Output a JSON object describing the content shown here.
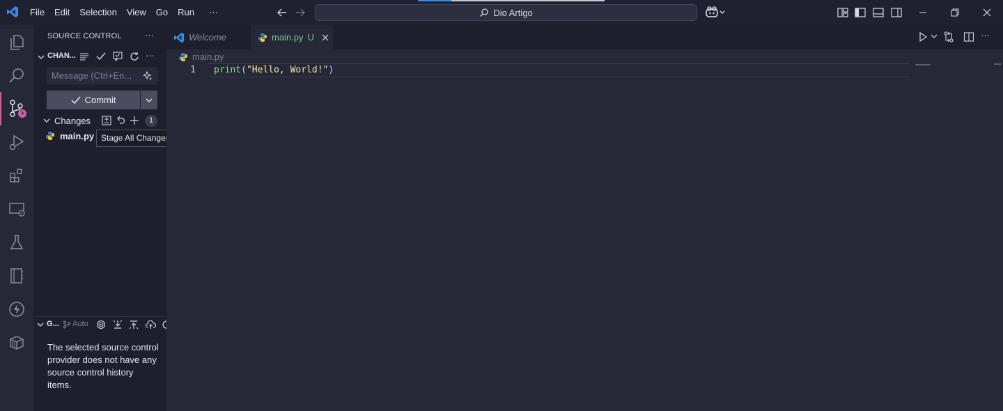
{
  "titlebar": {
    "menu": [
      "File",
      "Edit",
      "Selection",
      "View",
      "Go",
      "Run",
      "···"
    ],
    "search_text": "Dio Artigo",
    "icons": [
      "vscode-logo-icon",
      "back-arrow-icon",
      "forward-arrow-icon",
      "search-icon",
      "copilot-icon",
      "customize-layout-icon",
      "toggle-primary-sidebar-icon",
      "toggle-panel-icon",
      "toggle-secondary-sidebar-icon",
      "minimize-icon",
      "restore-icon",
      "close-icon"
    ]
  },
  "activitybar": {
    "items": [
      "explorer",
      "search",
      "source-control",
      "run-and-debug",
      "extensions",
      "remote-explorer",
      "testing",
      "notebook",
      "thunder",
      "containers"
    ]
  },
  "sidebar": {
    "title": "SOURCE CONTROL",
    "more": "···",
    "changes_header": "CHAN...",
    "commit_message_placeholder": "Message (Ctrl+En...",
    "commit_label": "Commit",
    "changes_label": "Changes",
    "changes_count": "1",
    "file_name": "main.py",
    "tooltip": "Stage All Changes",
    "graph_header": "G...",
    "graph_auto": "Auto",
    "history_message": "The selected source control provider does not have any source control history items."
  },
  "editor": {
    "tabs": [
      {
        "label": "Welcome",
        "active": false
      },
      {
        "label": "main.py",
        "status": "U",
        "active": true
      }
    ],
    "breadcrumb": "main.py",
    "line_number": "1",
    "code": {
      "fn": "print",
      "open": "(",
      "str": "\"Hello, World!\"",
      "close": ")"
    }
  },
  "colors": {
    "accent_blue": "#3c8ce0",
    "source_control_badge": "#d35e9e",
    "untracked_green": "#73c991",
    "function_green": "#8ee08a",
    "string_yellow": "#f3ea9f"
  }
}
